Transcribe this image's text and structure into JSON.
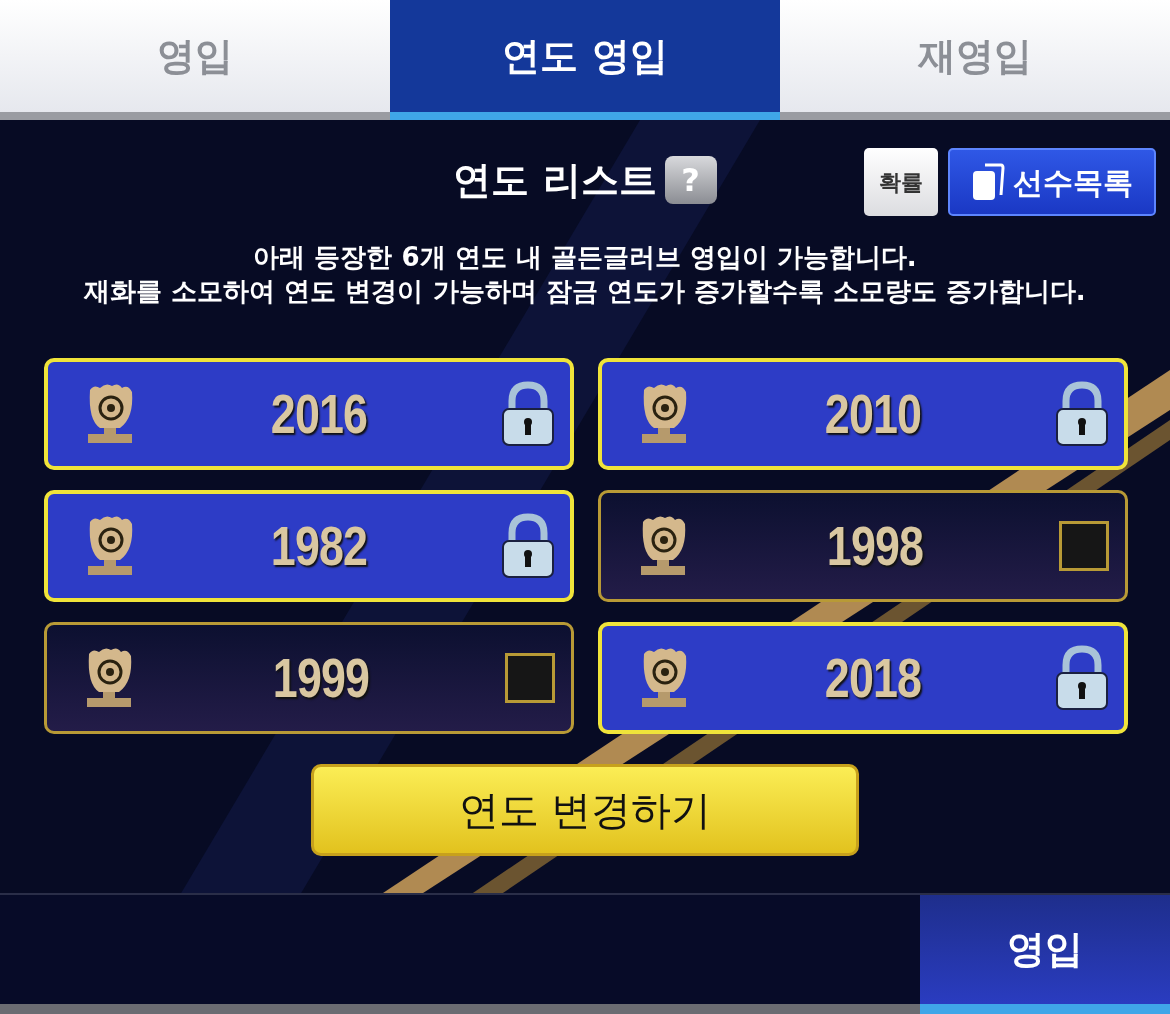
{
  "tabs": [
    {
      "label": "영입",
      "selected": false
    },
    {
      "label": "연도 영입",
      "selected": true
    },
    {
      "label": "재영입",
      "selected": false
    }
  ],
  "header": {
    "title": "연도 리스트",
    "help": "?",
    "buttons": [
      {
        "kind": "plain",
        "label": "확률"
      },
      {
        "kind": "cards",
        "label": "선수목록"
      }
    ]
  },
  "description": [
    "아래 등장한 6개 연도 내 골든글러브 영입이 가능합니다.",
    "재화를 소모하여 연도 변경이 가능하며 잠금 연도가 증가할수록 소모량도 증가합니다."
  ],
  "years": [
    {
      "year": "2016",
      "locked": true
    },
    {
      "year": "2010",
      "locked": true
    },
    {
      "year": "1982",
      "locked": true
    },
    {
      "year": "1998",
      "locked": false
    },
    {
      "year": "1999",
      "locked": false
    },
    {
      "year": "2018",
      "locked": true
    }
  ],
  "change_button": "연도 변경하기",
  "bottom_tabs": [
    {
      "label": "영입",
      "selected": true
    }
  ]
}
